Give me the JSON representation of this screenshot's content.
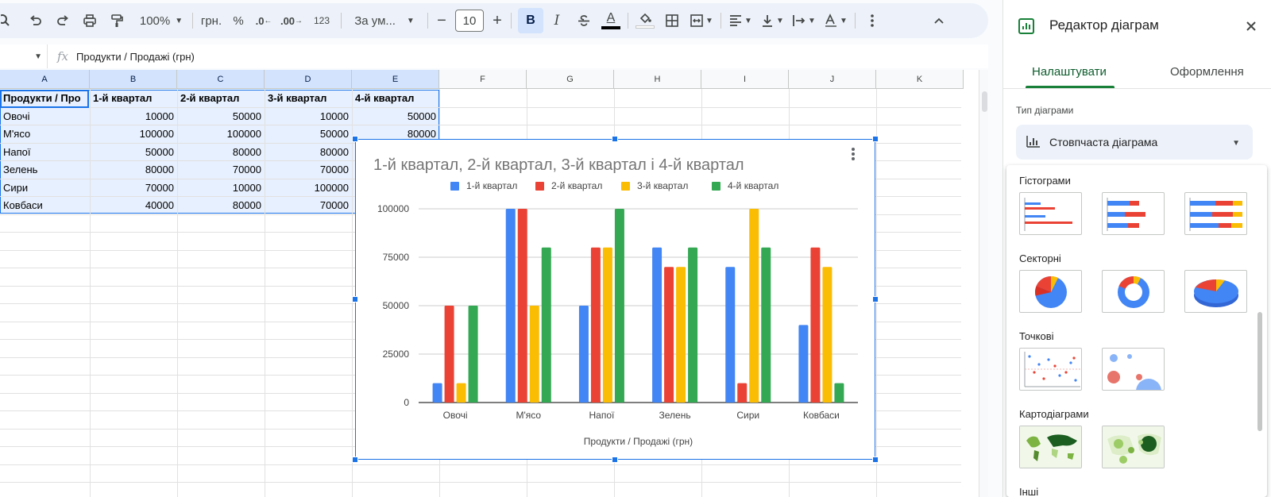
{
  "toolbar": {
    "zoom": "100%",
    "currency": "грн.",
    "percent": "%",
    "dec_decrease": ".0",
    "dec_increase": ".00",
    "number_format": "123",
    "font": "За ум...",
    "font_size": "10",
    "bold": "B",
    "italic": "I",
    "text_color": "A"
  },
  "formula_bar": {
    "fx": "fx",
    "content": "Продукти / Продажі (грн)"
  },
  "columns": [
    "A",
    "B",
    "C",
    "D",
    "E",
    "F",
    "G",
    "H",
    "I",
    "J",
    "K"
  ],
  "sheet": {
    "header": [
      "Продукти / Про",
      "1-й квартал",
      "2-й квартал",
      "3-й квартал",
      "4-й квартал"
    ],
    "rows": [
      {
        "label": "Овочі",
        "v": [
          "10000",
          "50000",
          "10000",
          "50000"
        ]
      },
      {
        "label": "М'ясо",
        "v": [
          "100000",
          "100000",
          "50000",
          "80000"
        ]
      },
      {
        "label": "Напої",
        "v": [
          "50000",
          "80000",
          "80000",
          ""
        ]
      },
      {
        "label": "Зелень",
        "v": [
          "80000",
          "70000",
          "70000",
          ""
        ]
      },
      {
        "label": "Сири",
        "v": [
          "70000",
          "10000",
          "100000",
          ""
        ]
      },
      {
        "label": "Ковбаси",
        "v": [
          "40000",
          "80000",
          "70000",
          ""
        ]
      }
    ]
  },
  "chart_data": {
    "type": "bar",
    "title": "1-й квартал, 2-й квартал, 3-й квартал і 4-й квартал",
    "xlabel": "Продукти / Продажі (грн)",
    "ylabel": "",
    "categories": [
      "Овочі",
      "М'ясо",
      "Напої",
      "Зелень",
      "Сири",
      "Ковбаси"
    ],
    "series": [
      {
        "name": "1-й квартал",
        "color": "#4285f4",
        "values": [
          10000,
          100000,
          50000,
          80000,
          70000,
          40000
        ]
      },
      {
        "name": "2-й квартал",
        "color": "#ea4335",
        "values": [
          50000,
          100000,
          80000,
          70000,
          10000,
          80000
        ]
      },
      {
        "name": "3-й квартал",
        "color": "#fbbc04",
        "values": [
          10000,
          50000,
          80000,
          70000,
          100000,
          70000
        ]
      },
      {
        "name": "4-й квартал",
        "color": "#34a853",
        "values": [
          50000,
          80000,
          100000,
          80000,
          80000,
          10000
        ]
      }
    ],
    "ylim": [
      0,
      100000
    ],
    "yticks": [
      "0",
      "25000",
      "50000",
      "75000",
      "100000"
    ],
    "legend": "top",
    "grid": true
  },
  "panel": {
    "title": "Редактор діаграм",
    "tab_setup": "Налаштувати",
    "tab_customize": "Оформлення",
    "chart_type_label": "Тип діаграми",
    "chart_type_value": "Стовпчаста діаграма",
    "categories": [
      "Гістограми",
      "Секторні",
      "Точкові",
      "Картодіаграми",
      "Інші"
    ]
  }
}
